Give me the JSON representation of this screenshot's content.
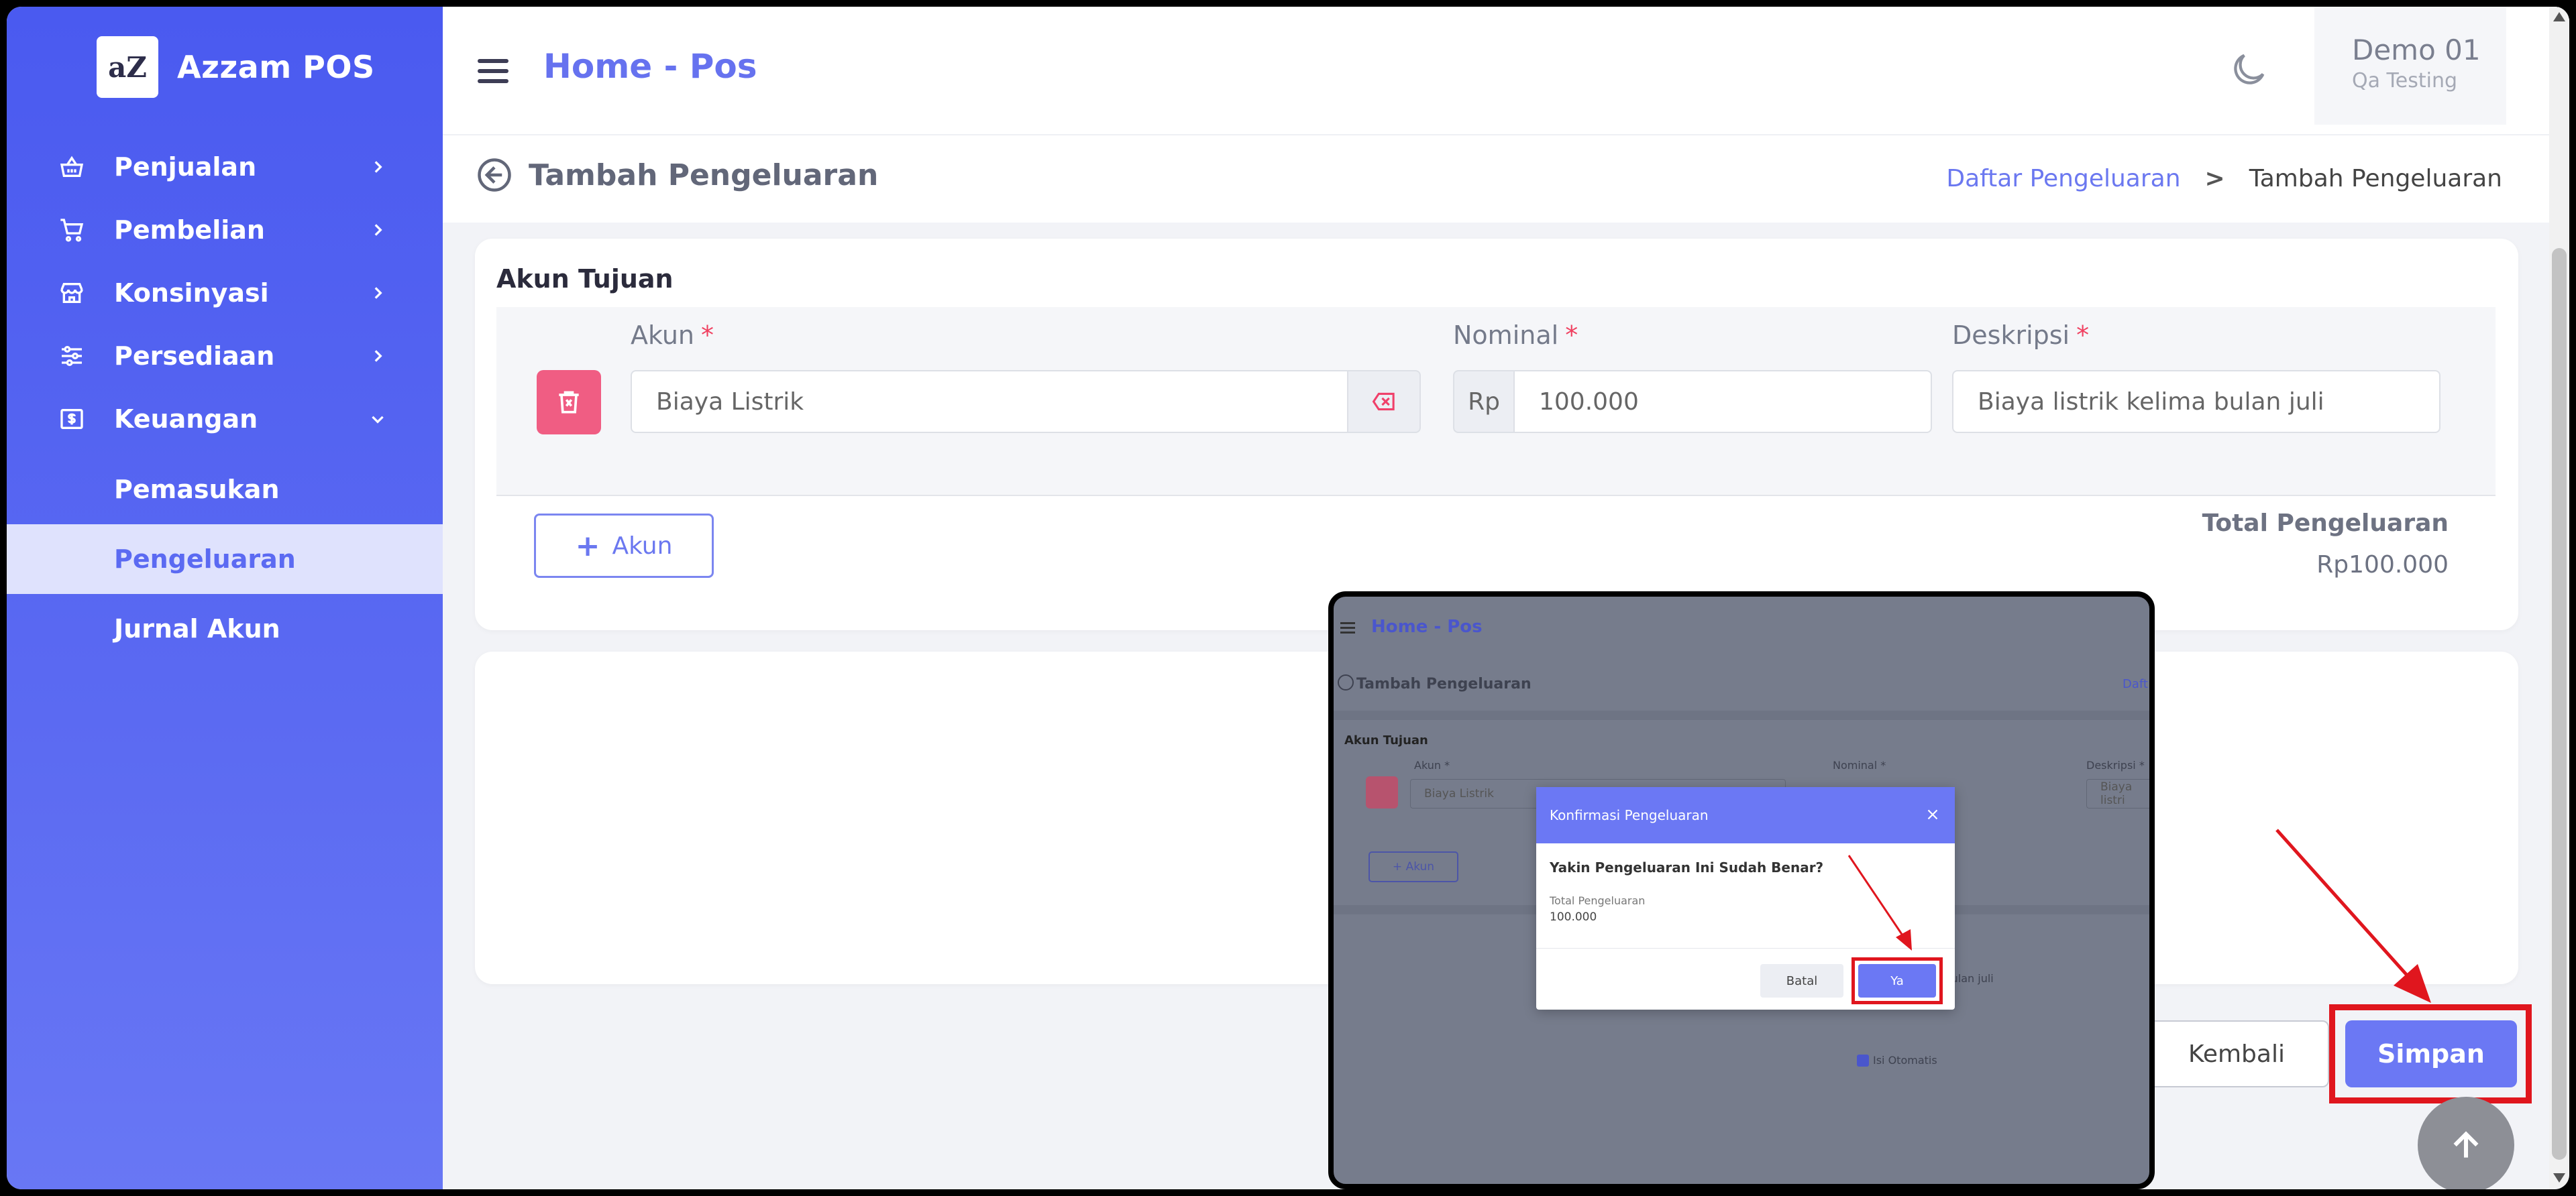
{
  "brand": {
    "logo": "aZ",
    "name": "Azzam POS"
  },
  "sidebar": {
    "items": [
      {
        "label": "Penjualan",
        "icon": "basket-icon"
      },
      {
        "label": "Pembelian",
        "icon": "cart-icon"
      },
      {
        "label": "Konsinyasi",
        "icon": "store-icon"
      },
      {
        "label": "Persediaan",
        "icon": "sliders-icon"
      },
      {
        "label": "Keuangan",
        "icon": "money-icon"
      }
    ],
    "subitems": [
      {
        "label": "Pemasukan"
      },
      {
        "label": "Pengeluaran"
      },
      {
        "label": "Jurnal Akun"
      }
    ]
  },
  "header": {
    "title": "Home - Pos",
    "user_name": "Demo 01",
    "user_role": "Qa Testing"
  },
  "subheader": {
    "title": "Tambah Pengeluaran",
    "breadcrumb_link": "Daftar Pengeluaran",
    "breadcrumb_sep": ">",
    "breadcrumb_current": "Tambah Pengeluaran"
  },
  "form": {
    "section_title": "Akun Tujuan",
    "akun_label": "Akun",
    "nominal_label": "Nominal",
    "deskripsi_label": "Deskripsi",
    "required_mark": "*",
    "akun_value": "Biaya Listrik",
    "currency_prefix": "Rp",
    "nominal_value": "100.000",
    "deskripsi_value": "Biaya listrik kelima bulan juli",
    "add_button": "Akun",
    "add_plus": "+",
    "total_label": "Total Pengeluaran",
    "total_value": "Rp100.000"
  },
  "actions": {
    "back_label": "Kembali",
    "save_label": "Simpan"
  },
  "inset": {
    "title": "Home - Pos",
    "subtitle": "Tambah Pengeluaran",
    "breadcrumb_partial": "Daft",
    "section_title": "Akun Tujuan",
    "akun_label": "Akun *",
    "nominal_label": "Nominal *",
    "deskripsi_label": "Deskripsi *",
    "akun_value": "Biaya Listrik",
    "deskripsi_partial": "Biaya listri",
    "add_button": "+ Akun",
    "desc_tail": "ma bulan juli",
    "checkbox_label": "Isi Otomatis",
    "modal": {
      "title": "Konfirmasi Pengeluaran",
      "question": "Yakin Pengeluaran Ini Sudah Benar?",
      "total_label": "Total Pengeluaran",
      "total_value": "100.000",
      "cancel": "Batal",
      "confirm": "Ya"
    }
  },
  "colors": {
    "sidebar": "#4a5af0",
    "accent": "#6b78f4",
    "danger": "#f05d83",
    "highlight": "#e0161e"
  }
}
